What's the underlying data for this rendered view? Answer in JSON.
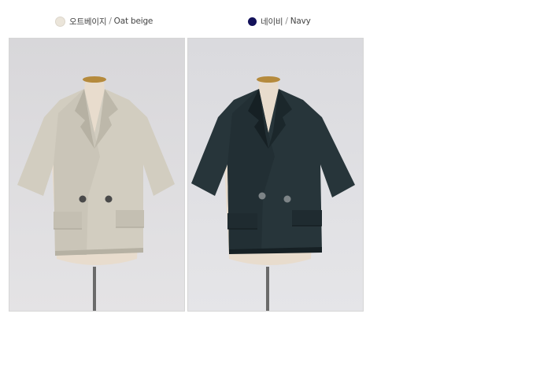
{
  "colors": [
    {
      "korean": "오트베이지",
      "sep": "/",
      "english": "Oat beige",
      "swatch": "#ebe5da",
      "jacket": "#d2cdc0",
      "jacket_shade": "#b6b1a3"
    },
    {
      "korean": "네이비",
      "sep": "/",
      "english": "Navy",
      "swatch": "#13115a",
      "jacket": "#27353a",
      "jacket_shade": "#162024"
    }
  ],
  "photo_backdrop": "#dcdbdd",
  "photo_items": [
    {
      "icon": "jacket-on-mannequin-image",
      "color_index": 0
    },
    {
      "icon": "jacket-on-mannequin-image",
      "color_index": 1
    }
  ]
}
